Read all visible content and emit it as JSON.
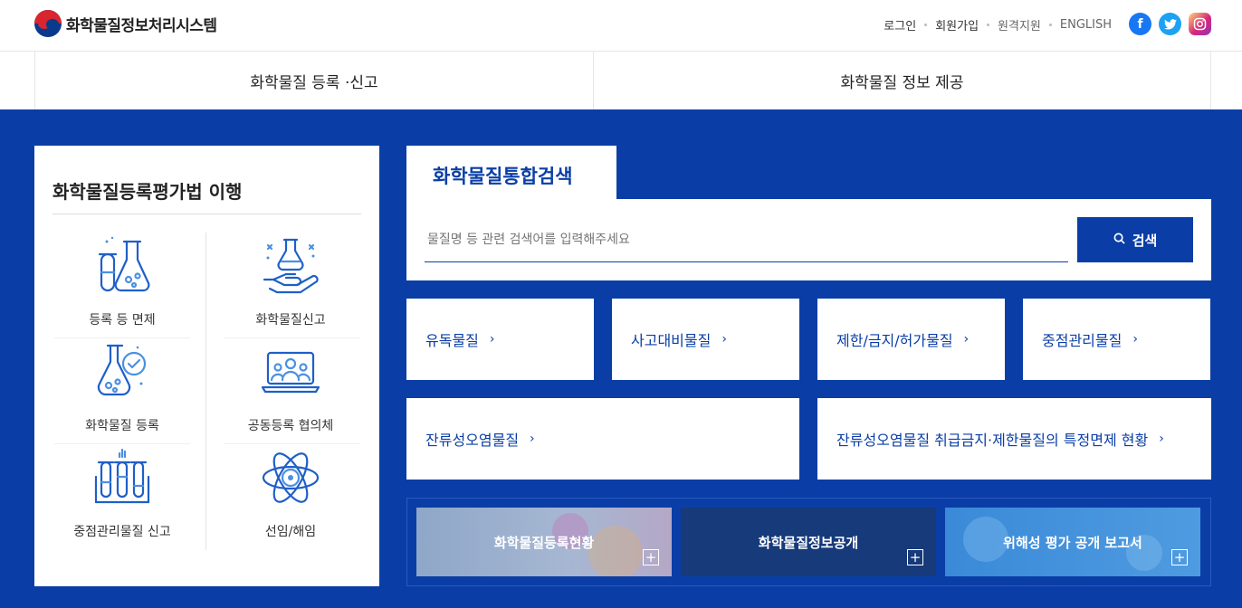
{
  "header": {
    "site_title": "화학물질정보처리시스템",
    "util_links": [
      "로그인",
      "회원가입",
      "원격지원",
      "ENGLISH"
    ],
    "social": [
      {
        "icon": "facebook-icon",
        "glyph": "f"
      },
      {
        "icon": "twitter-icon",
        "glyph": "t"
      },
      {
        "icon": "instagram-icon",
        "glyph": "◎"
      }
    ]
  },
  "gnb": {
    "items": [
      "화학물질 등록 ·신고",
      "화학물질 정보 제공"
    ]
  },
  "law_panel": {
    "title": "화학물질등록평가법 이행",
    "items": [
      {
        "label": "등록 등 면제",
        "icon": "flask-tubes-icon"
      },
      {
        "label": "화학물질신고",
        "icon": "hand-flask-icon"
      },
      {
        "label": "화학물질 등록",
        "icon": "flask-check-icon"
      },
      {
        "label": "공동등록 협의체",
        "icon": "laptop-group-icon"
      },
      {
        "label": "중점관리물질 신고",
        "icon": "test-tubes-icon"
      },
      {
        "label": "선임/해임",
        "icon": "atom-icon"
      }
    ]
  },
  "search": {
    "tab_label": "화학물질통합검색",
    "placeholder": "물질명 등 관련 검색어를 입력해주세요",
    "button_label": "검색"
  },
  "categories": [
    {
      "label": "유독물질",
      "arrow": "›"
    },
    {
      "label": "사고대비물질",
      "arrow": "›"
    },
    {
      "label": "제한/금지/허가물질",
      "arrow": "›"
    },
    {
      "label": "중점관리물질",
      "arrow": "›"
    },
    {
      "label": "잔류성오염물질",
      "arrow": "›"
    },
    {
      "label": "잔류성오염물질 취급금지·제한물질의 특정면제 현황",
      "arrow": "›"
    }
  ],
  "banners": [
    {
      "label": "화학물질등록현황",
      "plus": "+"
    },
    {
      "label": "화학물질정보공개",
      "plus": "+"
    },
    {
      "label": "위해성 평가 공개 보고서",
      "plus": "+"
    }
  ],
  "colors": {
    "primary": "#0a3ea6",
    "dark_banner": "#163a7a",
    "light_banner": "#4f9be0"
  }
}
